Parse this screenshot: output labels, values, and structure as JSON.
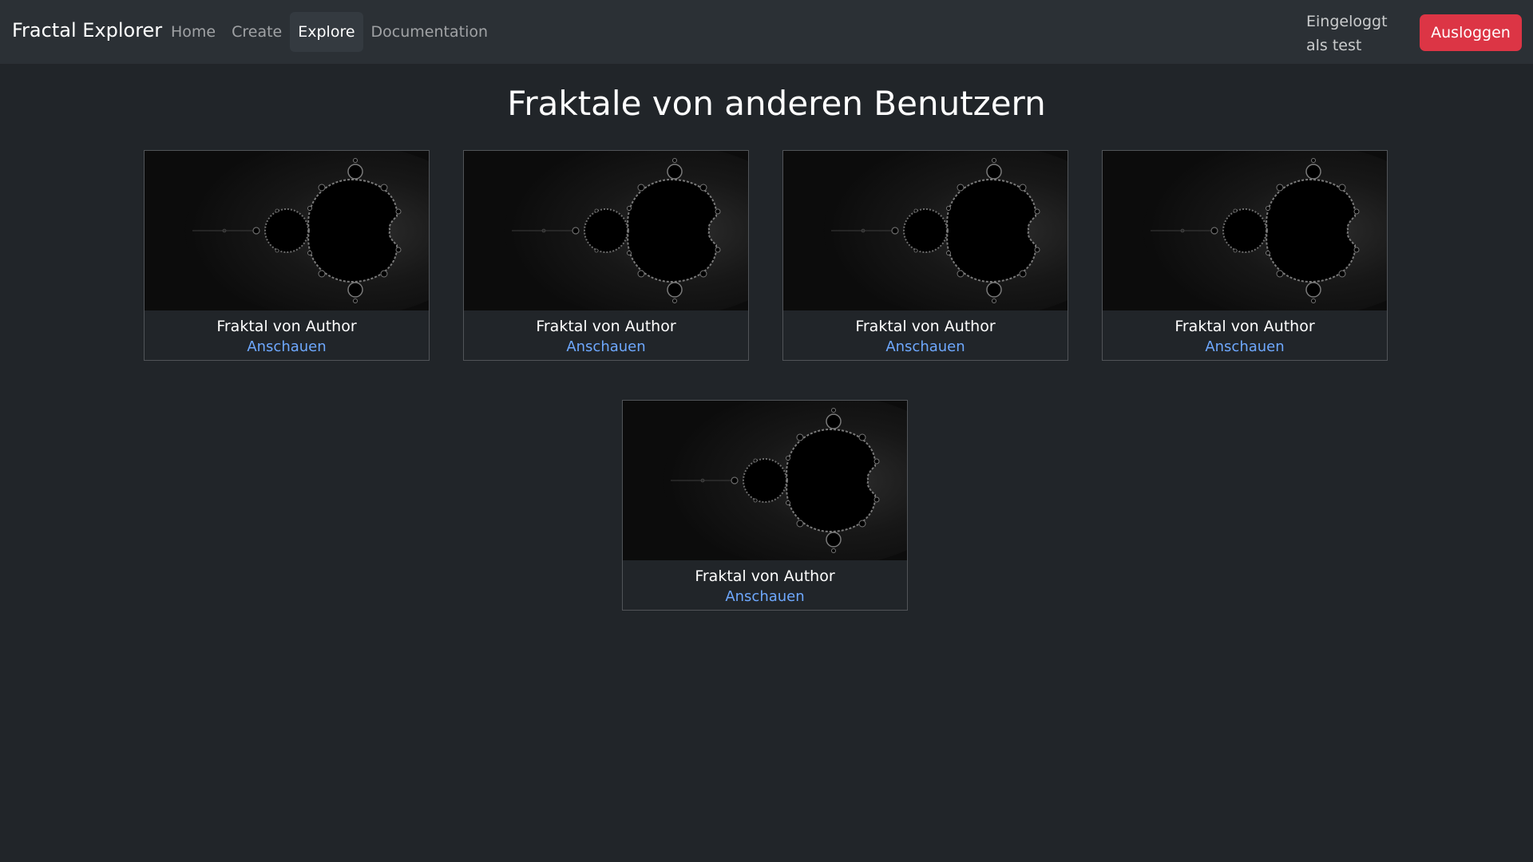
{
  "navbar": {
    "brand": "Fractal Explorer",
    "links": [
      {
        "label": "Home",
        "active": false
      },
      {
        "label": "Create",
        "active": false
      },
      {
        "label": "Explore",
        "active": true
      },
      {
        "label": "Documentation",
        "active": false
      }
    ],
    "user_status": "Eingeloggt als test",
    "logout_label": "Ausloggen"
  },
  "main": {
    "title": "Fraktale von anderen Benutzern",
    "cards": [
      {
        "title": "Fraktal von Author",
        "link_label": "Anschauen"
      },
      {
        "title": "Fraktal von Author",
        "link_label": "Anschauen"
      },
      {
        "title": "Fraktal von Author",
        "link_label": "Anschauen"
      },
      {
        "title": "Fraktal von Author",
        "link_label": "Anschauen"
      },
      {
        "title": "Fraktal von Author",
        "link_label": "Anschauen"
      }
    ]
  },
  "colors": {
    "background": "#212529",
    "navbar": "#2b3035",
    "danger": "#dc3545",
    "link": "#6ea8fe"
  }
}
